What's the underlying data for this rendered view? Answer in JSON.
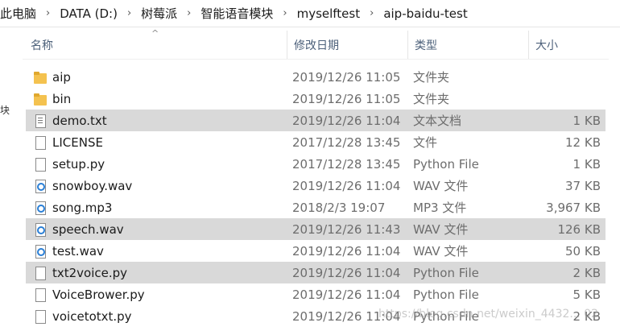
{
  "breadcrumb": {
    "items": [
      "此电脑",
      "DATA (D:)",
      "树莓派",
      "智能语音模块",
      "myselftest",
      "aip-baidu-test"
    ],
    "separator": "›"
  },
  "columns": {
    "name": "名称",
    "date": "修改日期",
    "type": "类型",
    "size": "大小",
    "sort_indicator": "^"
  },
  "left_edge_text": "块",
  "files": [
    {
      "name": "aip",
      "date": "2019/12/26 11:05",
      "type": "文件夹",
      "size": "",
      "icon": "folder-icon",
      "selected": false
    },
    {
      "name": "bin",
      "date": "2019/12/26 11:05",
      "type": "文件夹",
      "size": "",
      "icon": "folder-icon",
      "selected": false
    },
    {
      "name": "demo.txt",
      "date": "2019/12/26 11:04",
      "type": "文本文档",
      "size": "1 KB",
      "icon": "text-file-icon",
      "selected": true
    },
    {
      "name": "LICENSE",
      "date": "2017/12/28 13:45",
      "type": "文件",
      "size": "12 KB",
      "icon": "file-icon",
      "selected": false
    },
    {
      "name": "setup.py",
      "date": "2017/12/28 13:45",
      "type": "Python File",
      "size": "1 KB",
      "icon": "file-icon",
      "selected": false
    },
    {
      "name": "snowboy.wav",
      "date": "2019/12/26 11:04",
      "type": "WAV 文件",
      "size": "37 KB",
      "icon": "audio-file-icon",
      "selected": false
    },
    {
      "name": "song.mp3",
      "date": "2018/2/3 19:07",
      "type": "MP3 文件",
      "size": "3,967 KB",
      "icon": "audio-file-icon",
      "selected": false
    },
    {
      "name": "speech.wav",
      "date": "2019/12/26 11:43",
      "type": "WAV 文件",
      "size": "126 KB",
      "icon": "audio-file-icon",
      "selected": true
    },
    {
      "name": "test.wav",
      "date": "2019/12/26 11:04",
      "type": "WAV 文件",
      "size": "50 KB",
      "icon": "audio-file-icon",
      "selected": false
    },
    {
      "name": "txt2voice.py",
      "date": "2019/12/26 11:04",
      "type": "Python File",
      "size": "2 KB",
      "icon": "file-icon",
      "selected": true
    },
    {
      "name": "VoiceBrower.py",
      "date": "2019/12/26 11:04",
      "type": "Python File",
      "size": "5 KB",
      "icon": "file-icon",
      "selected": false
    },
    {
      "name": "voicetotxt.py",
      "date": "2019/12/26 11:04",
      "type": "Python File",
      "size": "2 KB",
      "icon": "file-icon",
      "selected": false
    }
  ],
  "watermark": "https://blog.csdn.net/weixin_4432... 02"
}
